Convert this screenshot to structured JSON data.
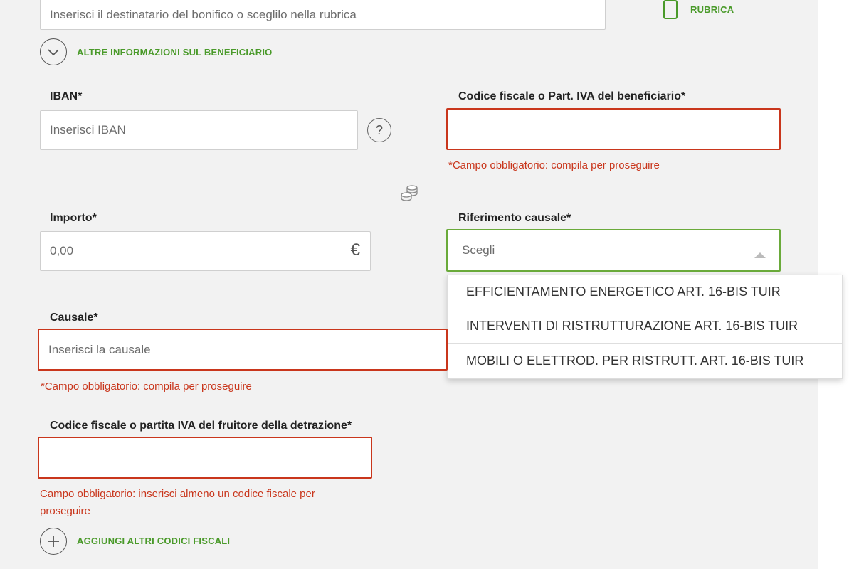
{
  "beneficiary": {
    "name_placeholder": "Inserisci il destinatario del bonifico o sceglilo nella rubrica",
    "rubrica_label": "RUBRICA",
    "more_info_label": "ALTRE INFORMAZIONI SUL BENEFICIARIO"
  },
  "iban": {
    "label": "IBAN*",
    "placeholder": "Inserisci IBAN",
    "help_symbol": "?"
  },
  "beneficiary_tax_code": {
    "label": "Codice fiscale o Part. IVA del beneficiario*",
    "value": "",
    "error": "*Campo obbligatorio: compila per proseguire"
  },
  "amount": {
    "label": "Importo*",
    "placeholder": "0,00",
    "currency_symbol": "€"
  },
  "reason_reference": {
    "label": "Riferimento causale*",
    "selected": "Scegli",
    "options": [
      "EFFICIENTAMENTO ENERGETICO ART. 16-BIS TUIR",
      "INTERVENTI DI RISTRUTTURAZIONE ART. 16-BIS TUIR",
      "MOBILI O ELETTROD. PER RISTRUTT. ART. 16-BIS TUIR"
    ]
  },
  "causale": {
    "label": "Causale*",
    "placeholder": "Inserisci la causale",
    "error": "*Campo obbligatorio: compila per proseguire"
  },
  "deduction_tax_code": {
    "label": "Codice fiscale o partita IVA del fruitore della detrazione*",
    "value": "",
    "error_line1": "Campo obbligatorio: inserisci almeno un codice fiscale per",
    "error_line2": "proseguire",
    "add_more_label": "AGGIUNGI ALTRI CODICI FISCALI"
  },
  "icons": [
    "address-book-icon",
    "chevron-down-icon",
    "help-icon",
    "coins-icon",
    "euro-icon",
    "triangle-up-icon",
    "plus-icon"
  ],
  "colors": {
    "accent_green": "#4a9a2a",
    "error_red": "#c9361c",
    "focus_green": "#6aaa3a",
    "page_bg": "#f2f2f2"
  }
}
